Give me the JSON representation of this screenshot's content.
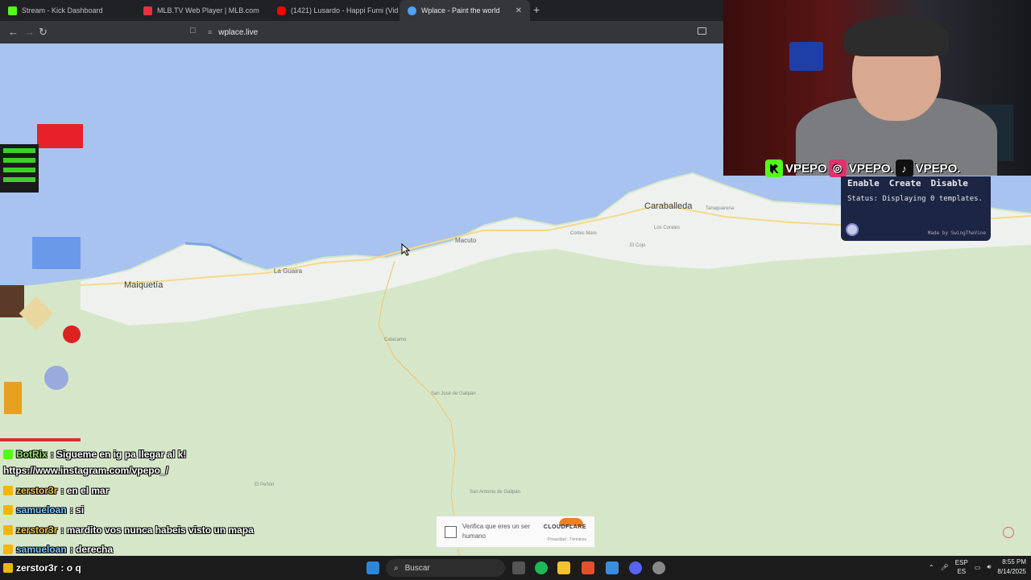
{
  "browser": {
    "tabs": [
      {
        "label": "Stream - Kick Dashboard",
        "color": "#53fc18",
        "active": false
      },
      {
        "label": "MLB.TV Web Player | MLB.com",
        "color": "#e8303d",
        "active": false
      },
      {
        "label": "(1421) Lusardo - Happi Fumi (Video",
        "color": "#ff0000",
        "active": false
      },
      {
        "label": "Wplace - Paint the world",
        "color": "#4fa3ff",
        "active": true
      }
    ],
    "new_tab": "+",
    "tab_close": "✕",
    "url": "wplace.live"
  },
  "map": {
    "places": [
      {
        "name": "Caraballeda",
        "size": "big"
      },
      {
        "name": "Maiquetía",
        "size": "big"
      },
      {
        "name": "La Guaira",
        "size": "med"
      },
      {
        "name": "Macuto",
        "size": "med"
      },
      {
        "name": "Catacamo",
        "size": "small"
      },
      {
        "name": "San José de Galipán",
        "size": "small"
      },
      {
        "name": "El Peñón",
        "size": "small"
      },
      {
        "name": "San Antonio de Galipán",
        "size": "small"
      },
      {
        "name": "Tanaguarena",
        "size": "small"
      },
      {
        "name": "Los Corales",
        "size": "small"
      },
      {
        "name": "El Cojo",
        "size": "small"
      },
      {
        "name": "Cortes Mare",
        "size": "small"
      }
    ],
    "sea_color": "#a8c3ef",
    "land_color": "#d5e7c8"
  },
  "stream": {
    "socials": [
      {
        "icon": "K",
        "handle": "VPEPO",
        "color": "#53fc18"
      },
      {
        "icon": "◎",
        "handle": "VPEPO.",
        "color": "#e1306c"
      },
      {
        "icon": "♪",
        "handle": "VPEPO.",
        "color": "#111111"
      }
    ]
  },
  "template_panel": {
    "enable": "Enable",
    "create": "Create",
    "disable": "Disable",
    "status": "Status: Displaying 0 templates.",
    "credit": "Made by SwingTheVine"
  },
  "chat": [
    {
      "user": "BotRix",
      "text": ": Sigueme en ig pa llegar al k!",
      "user_class": "user"
    },
    {
      "user": "",
      "text": "https://www.instagram.com/vpepo_/",
      "user_class": "user"
    },
    {
      "user": "zerstor3r",
      "text": ": en el mar",
      "user_class": "user u2"
    },
    {
      "user": "samueloan",
      "text": ": si",
      "user_class": "user u3"
    },
    {
      "user": "zerstor3r",
      "text": ": mardito vos nunca habeis visto un mapa",
      "user_class": "user u2"
    },
    {
      "user": "samueloan",
      "text": ": derecha",
      "user_class": "user u3"
    }
  ],
  "last_chat": {
    "user": "zerstor3r",
    "text": ": o q"
  },
  "captcha": {
    "label": "Verifica que eres un ser humano",
    "brand": "CLOUDFLARE",
    "links": "Privacidad · Términos"
  },
  "taskbar": {
    "search": "Buscar",
    "lang_top": "ESP",
    "lang_bottom": "ES",
    "time": "8:55 PM",
    "date": "8/14/2025"
  }
}
